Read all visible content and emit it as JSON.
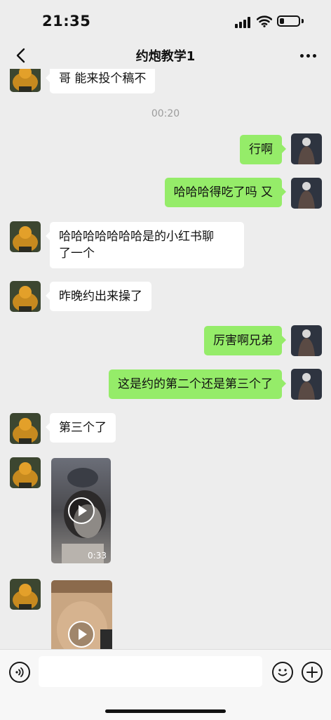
{
  "status_bar": {
    "time": "21:35",
    "battery_level": 0.25
  },
  "nav": {
    "title": "约炮教学1",
    "back_icon": "chevron-left-icon",
    "more_icon": "more-dots-icon"
  },
  "messages": [
    {
      "id": "m0",
      "side": "in",
      "text": "哥 能来投个稿不"
    },
    {
      "id": "ts",
      "type": "timestamp",
      "text": "00:20"
    },
    {
      "id": "m1",
      "side": "out",
      "text": "行啊"
    },
    {
      "id": "m2",
      "side": "out",
      "text": "哈哈哈得吃了吗 又"
    },
    {
      "id": "m3",
      "side": "in",
      "text": "哈哈哈哈哈哈哈是的小红书聊\n了一个"
    },
    {
      "id": "m4",
      "side": "in",
      "text": "昨晚约出来操了"
    },
    {
      "id": "m5",
      "side": "out",
      "text": "厉害啊兄弟"
    },
    {
      "id": "m6",
      "side": "out",
      "text": "这是约的第二个还是第三个了"
    },
    {
      "id": "m7",
      "side": "in",
      "text": "第三个了"
    },
    {
      "id": "m8",
      "side": "in",
      "type": "video",
      "duration": "0:33"
    },
    {
      "id": "m9",
      "side": "in",
      "type": "video",
      "duration": ""
    }
  ],
  "input_bar": {
    "voice_icon": "voice-icon",
    "emoji_icon": "emoji-icon",
    "add_icon": "plus-icon",
    "placeholder": ""
  },
  "colors": {
    "background": "#ededed",
    "outgoing_bubble": "#95ec69",
    "incoming_bubble": "#ffffff"
  }
}
